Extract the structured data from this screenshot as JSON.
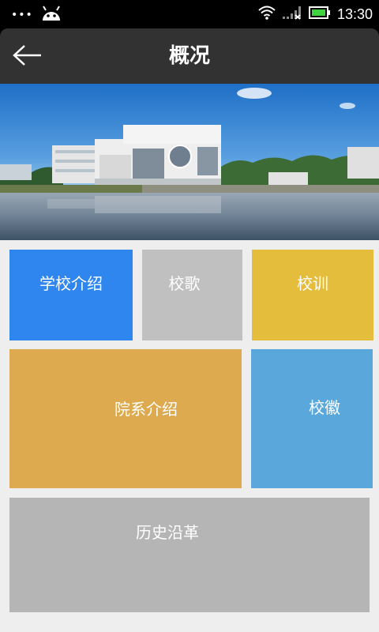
{
  "status_bar": {
    "dots": "•••",
    "time": "13:30",
    "icons": [
      "android-icon",
      "wifi-icon",
      "signal-icon",
      "battery-icon"
    ]
  },
  "header": {
    "title": "概况",
    "back_icon": "arrow-left-icon"
  },
  "hero": {
    "image": "campus-building-lake-photo"
  },
  "tiles": [
    {
      "label": "学校介绍",
      "color": "#2f86ee"
    },
    {
      "label": "校歌",
      "color": "#c0c0c0"
    },
    {
      "label": "校训",
      "color": "#e5bd3d"
    },
    {
      "label": "院系介绍",
      "color": "#deaa4f"
    },
    {
      "label": "校徽",
      "color": "#5aa8db"
    },
    {
      "label": "历史沿革",
      "color": "#b5b5b5"
    }
  ]
}
